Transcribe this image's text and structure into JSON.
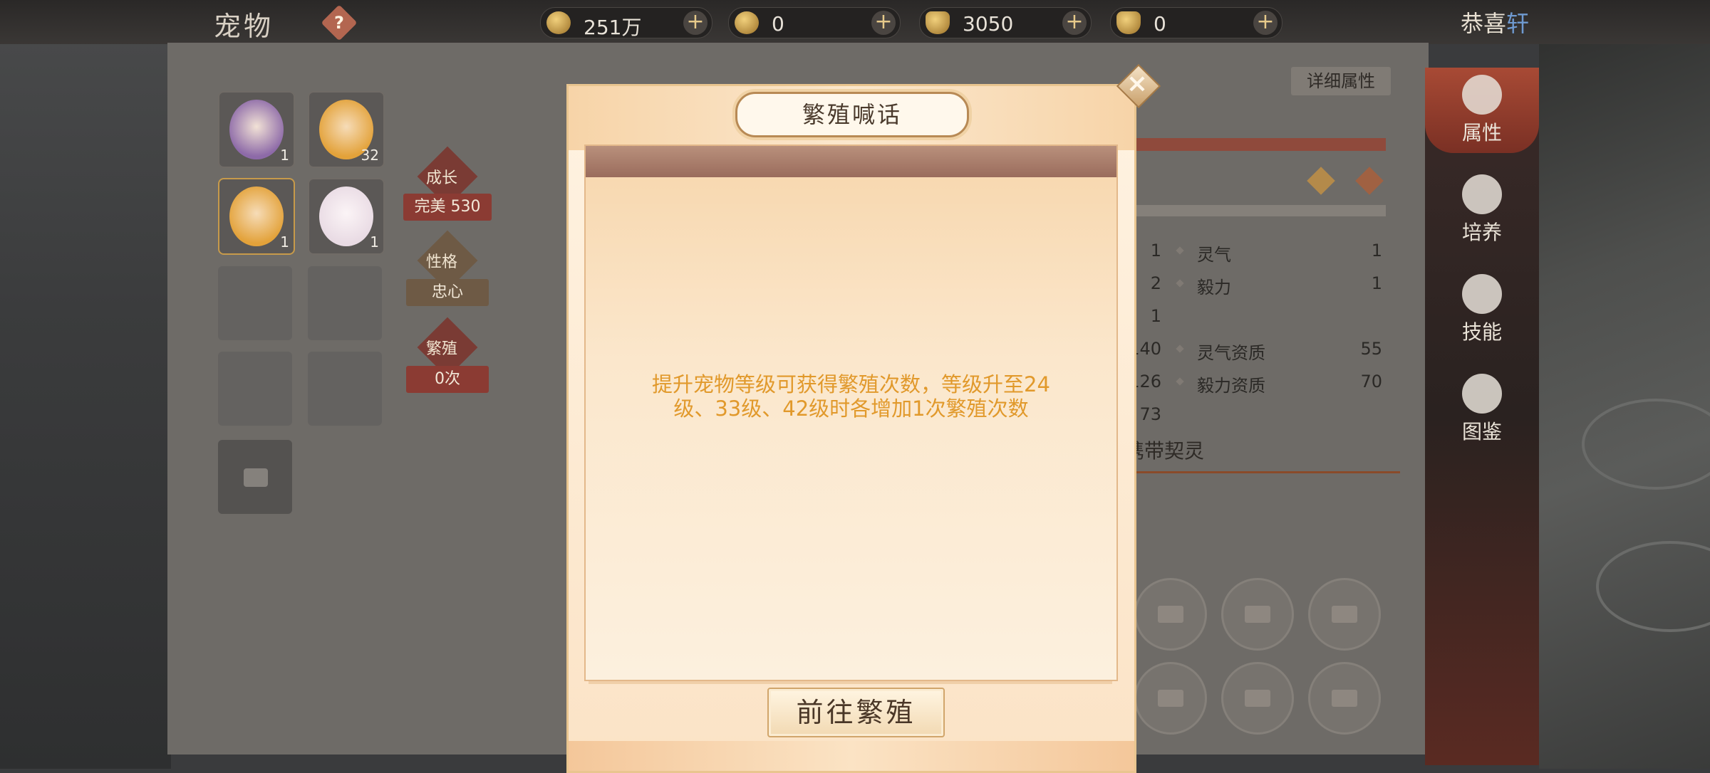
{
  "header": {
    "title": "宠物",
    "help_icon": "question-icon",
    "greeting_prefix": "恭喜",
    "greeting_name": "轩"
  },
  "currencies": [
    {
      "icon": "copper-coin-icon",
      "amount": "251万"
    },
    {
      "icon": "gold-coin-icon",
      "amount": "0"
    },
    {
      "icon": "ingot-icon",
      "amount": "3050"
    },
    {
      "icon": "gold-ingot-icon",
      "amount": "0"
    }
  ],
  "pets": [
    {
      "level": "1",
      "color": "#8d6aa8"
    },
    {
      "level": "32",
      "color": "#e3a23a"
    },
    {
      "level": "1",
      "color": "#e3a23a"
    },
    {
      "level": "1",
      "color": "#e9dbe4"
    }
  ],
  "pet_info": {
    "growth_badge": "成长",
    "growth_label": "完美",
    "growth_value": "530",
    "nature_badge": "性格",
    "nature_value": "忠心",
    "breed_badge": "繁殖",
    "breed_count": "0次",
    "detail_button": "详细属性"
  },
  "stats": {
    "right": [
      {
        "name": "灵气",
        "value": "1"
      },
      {
        "name": "毅力",
        "value": "1"
      },
      {
        "name": "灵气资质",
        "value": "55"
      },
      {
        "name": "毅力资质",
        "value": "70"
      }
    ],
    "left_numbers": [
      "1",
      "2",
      "1",
      "140",
      "126",
      "73"
    ],
    "section_title": "携带契灵"
  },
  "nav": [
    {
      "label": "属性",
      "icon": "paw-icon",
      "active": true
    },
    {
      "label": "培养",
      "icon": "cultivate-icon",
      "active": false
    },
    {
      "label": "技能",
      "icon": "scroll-icon",
      "active": false
    },
    {
      "label": "图鉴",
      "icon": "book-icon",
      "active": false
    }
  ],
  "modal": {
    "title": "繁殖喊话",
    "close_icon": "close-icon",
    "message": "提升宠物等级可获得繁殖次数，等级升至24级、33级、42级时各增加1次繁殖次数",
    "button": "前往繁殖"
  },
  "colors": {
    "modal_text": "#e1992b",
    "modal_bg": "#fbe3c6",
    "accent_red": "#8b3b33"
  }
}
